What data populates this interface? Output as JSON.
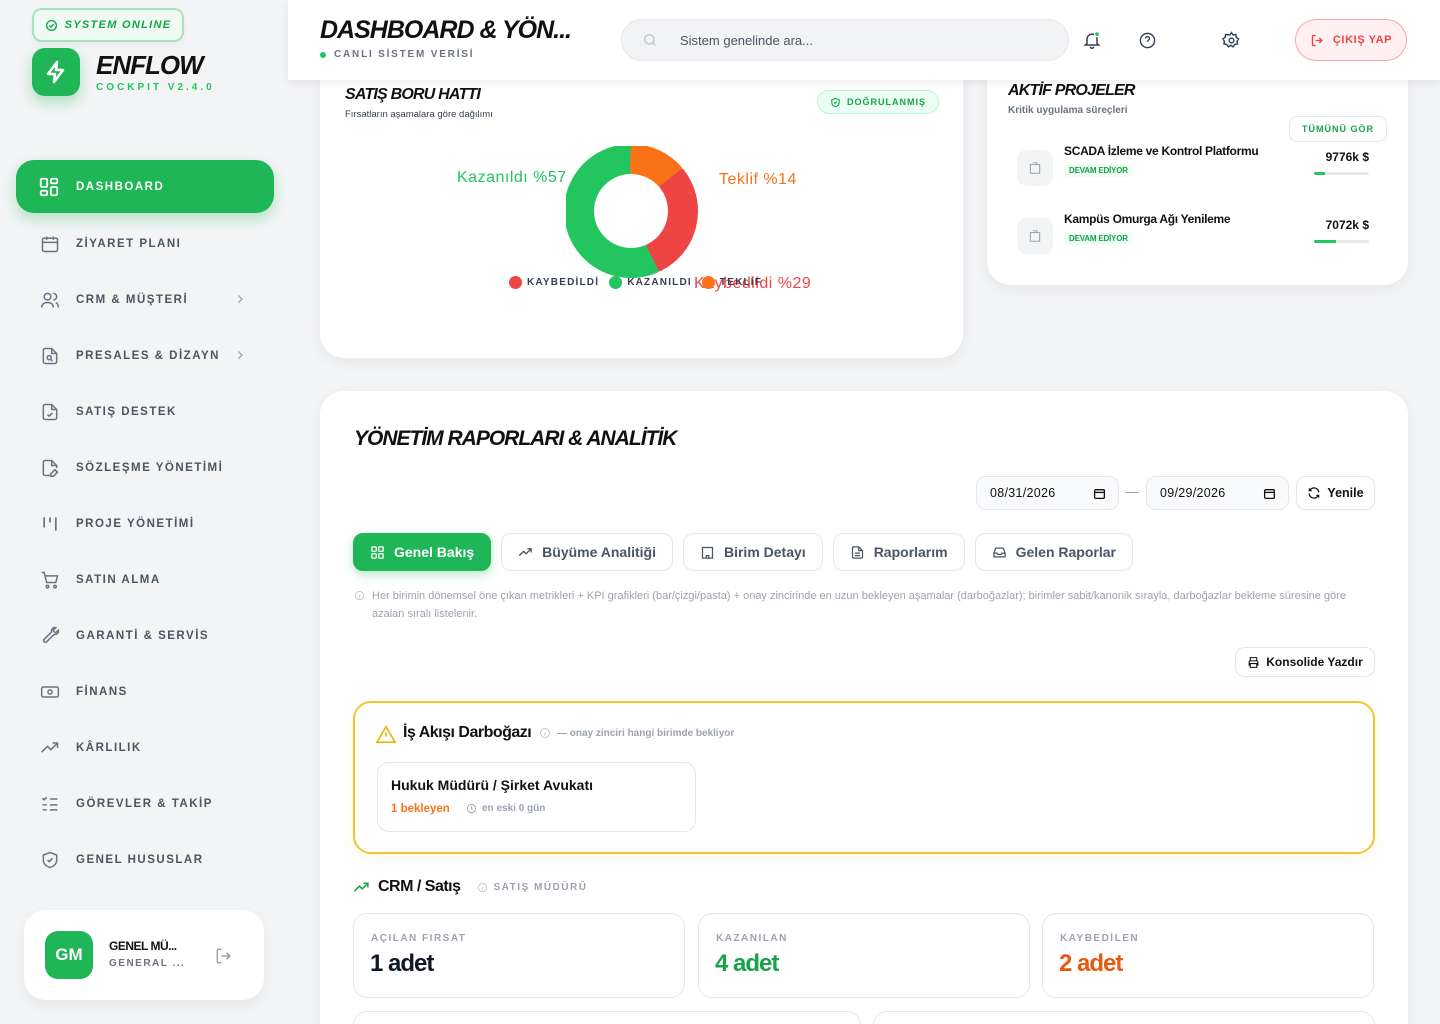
{
  "sidebar": {
    "status_badge": "SYSTEM ONLINE",
    "brand": "ENFLOW",
    "brand_sub": "COCKPIT V2.4.0",
    "items": [
      {
        "label": "DASHBOARD",
        "icon": "grid-icon",
        "active": true
      },
      {
        "label": "ZİYARET PLANI",
        "icon": "calendar-icon"
      },
      {
        "label": "CRM & MÜŞTERİ",
        "icon": "users-icon",
        "has_children": true
      },
      {
        "label": "PRESALES & DİZAYN",
        "icon": "file-search-icon",
        "has_children": true
      },
      {
        "label": "SATIŞ DESTEK",
        "icon": "file-check-icon"
      },
      {
        "label": "SÖZLEŞME YÖNETİMİ",
        "icon": "file-edit-icon"
      },
      {
        "label": "PROJE YÖNETİMİ",
        "icon": "kanban-icon"
      },
      {
        "label": "SATIN ALMA",
        "icon": "cart-icon"
      },
      {
        "label": "GARANTİ & SERVİS",
        "icon": "wrench-icon"
      },
      {
        "label": "FİNANS",
        "icon": "banknote-icon"
      },
      {
        "label": "KÂRLILIK",
        "icon": "trending-up-icon"
      },
      {
        "label": "GÖREVLER & TAKİP",
        "icon": "list-checks-icon"
      },
      {
        "label": "GENEL HUSUSLAR",
        "icon": "shield-check-icon"
      }
    ],
    "user": {
      "initials": "GM",
      "name": "GENEL MÜ...",
      "role": "GENERAL ..."
    }
  },
  "topbar": {
    "title": "DASHBOARD & YÖN...",
    "subtitle": "CANLI SİSTEM VERİSİ",
    "search_placeholder": "Sistem genelinde ara...",
    "logout_label": "ÇIKIŞ YAP"
  },
  "pipeline": {
    "title": "SATIŞ BORU HATTI",
    "subtitle": "Fırsatların aşamalara göre dağılımı",
    "badge": "DOĞRULANMIŞ",
    "labels": {
      "won": "Kazanıldı %57",
      "offer": "Teklif %14",
      "lost": "Kaybedildi %29"
    },
    "legend": [
      "KAYBEDİLDİ",
      "KAZANILDI",
      "TEKLİF"
    ],
    "colors": {
      "won": "#22c55e",
      "offer": "#f97316",
      "lost": "#ef4444"
    }
  },
  "chart_data": {
    "type": "pie",
    "categories": [
      "Kazanıldı",
      "Teklif",
      "Kaybedildi"
    ],
    "values": [
      57,
      14,
      29
    ],
    "legend": [
      "KAYBEDİLDİ",
      "KAZANILDI",
      "TEKLİF"
    ]
  },
  "projects": {
    "title": "AKTİF PROJELER",
    "subtitle": "Kritik uygulama süreçleri",
    "see_all": "TÜMÜNÜ GÖR",
    "items": [
      {
        "name": "SCADA İzleme ve Kontrol Platformu",
        "status": "DEVAM EDİYOR",
        "value": "9776k $",
        "progress": 0.2
      },
      {
        "name": "Kampüs Omurga Ağı Yenileme",
        "status": "DEVAM EDİYOR",
        "value": "7072k $",
        "progress": 0.4
      }
    ]
  },
  "reports": {
    "title": "YÖNETİM RAPORLARI & ANALİTİK",
    "date_from": "08/31/2026",
    "date_to": "09/29/2026",
    "refresh_label": "Yenile",
    "tabs": [
      {
        "label": "Genel Bakış",
        "icon": "grid-icon",
        "active": true
      },
      {
        "label": "Büyüme Analitiği",
        "icon": "trending-up-icon"
      },
      {
        "label": "Birim Detayı",
        "icon": "building-icon"
      },
      {
        "label": "Raporlarım",
        "icon": "file-text-icon"
      },
      {
        "label": "Gelen Raporlar",
        "icon": "inbox-icon"
      }
    ],
    "info": "Her birimin dönemsel öne çıkan metrikleri + KPI grafikleri (bar/çizgi/pasta) + onay zincirinde en uzun bekleyen aşamalar (darboğazlar); birimler sabit/kanonik sırayla, darboğazlar bekleme süresine göre azalan sıralı listelenir.",
    "print_label": "Konsolide Yazdır",
    "bottleneck": {
      "title": "İş Akışı Darboğazı",
      "hint": "— onay zinciri hangi birimde bekliyor",
      "item_name": "Hukuk Müdürü / Şirket Avukatı",
      "item_waiting": "1 bekleyen",
      "item_oldest": "en eski 0 gün"
    },
    "crm": {
      "title": "CRM / Satış",
      "role": "SATIŞ MÜDÜRÜ",
      "stats": [
        {
          "label": "AÇILAN FIRSAT",
          "value": "1 adet",
          "color": "#111827"
        },
        {
          "label": "KAZANILAN",
          "value": "4 adet",
          "color": "#16a34a"
        },
        {
          "label": "KAYBEDİLEN",
          "value": "2 adet",
          "color": "#ea580c"
        }
      ]
    }
  }
}
